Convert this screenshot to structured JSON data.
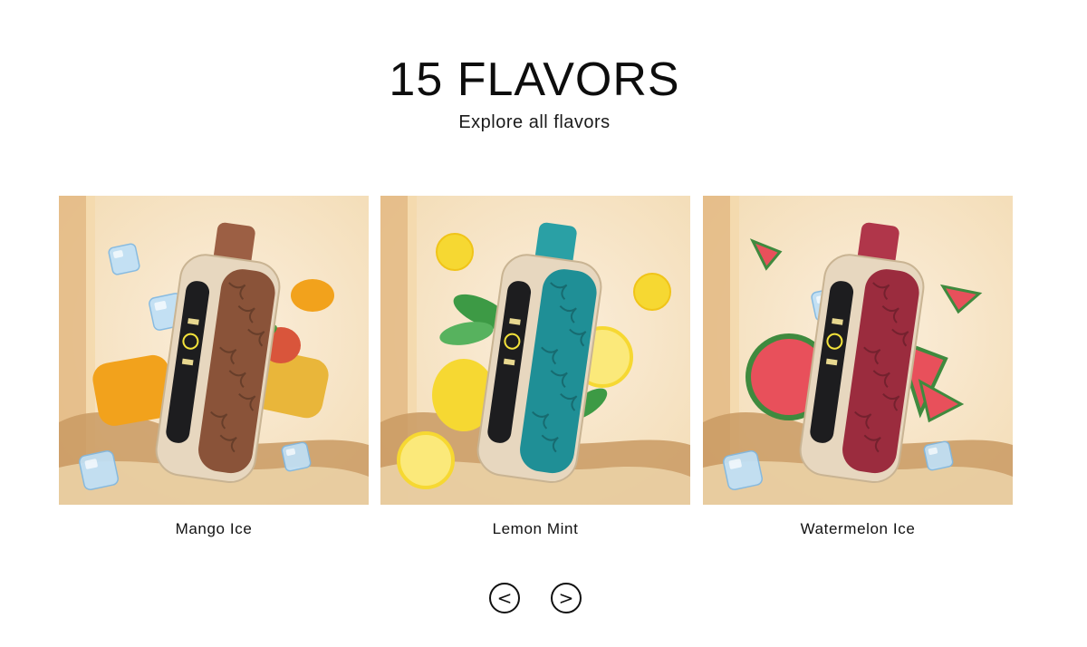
{
  "header": {
    "title": "15 FLAVORS",
    "subtitle": "Explore all flavors"
  },
  "products": [
    {
      "name": "Mango Ice",
      "colors": {
        "cap": "#9c5f44",
        "sleeve": "#8a5339",
        "fruit": "#f2a21c",
        "fruit_alt": "#e9b63a",
        "leaf": "#4b9a3a"
      },
      "icons": [
        "ice-cube-icon",
        "mango-icon"
      ]
    },
    {
      "name": "Lemon Mint",
      "colors": {
        "cap": "#2aa0a5",
        "sleeve": "#1f8f96",
        "fruit": "#f6d832",
        "fruit_alt": "#fbe97a",
        "leaf": "#3d9a45"
      },
      "icons": [
        "lemon-icon",
        "mint-leaf-icon"
      ]
    },
    {
      "name": "Watermelon Ice",
      "colors": {
        "cap": "#b0364a",
        "sleeve": "#9b2c3e",
        "fruit": "#e8505b",
        "fruit_alt": "#3f8a3e",
        "leaf": "#3f8a3e"
      },
      "icons": [
        "ice-cube-icon",
        "watermelon-icon"
      ]
    }
  ],
  "navigation": {
    "prev_glyph": "<",
    "next_glyph": ">"
  },
  "theme": {
    "background_warm": "#f3dcb5",
    "background_light": "#fbeedb",
    "sand": "#c99a63",
    "device_body": "#e7d7bf"
  }
}
